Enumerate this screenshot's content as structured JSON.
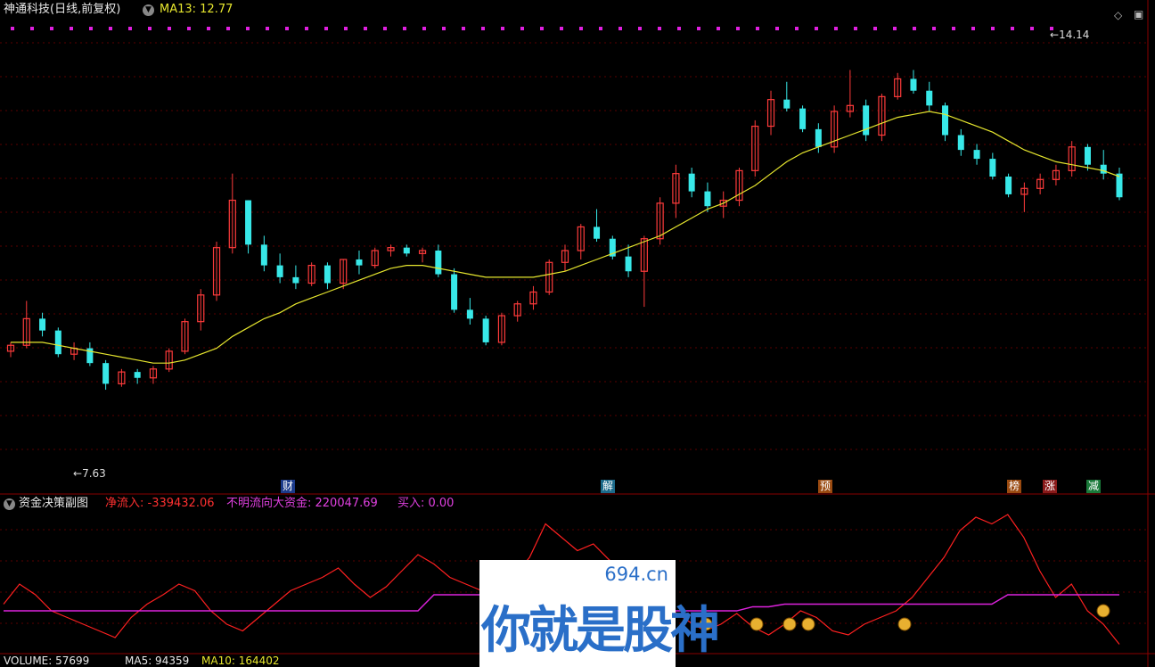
{
  "header": {
    "stock_name": "神通科技(日线,前复权)",
    "ma_label": "MA13: 12.77"
  },
  "price_labels": {
    "high": "14.14",
    "low": "7.63"
  },
  "markers": [
    {
      "text": "财",
      "color": "#1b3a8a"
    },
    {
      "text": "解",
      "color": "#1b6a8a"
    },
    {
      "text": "预",
      "color": "#9a4a10"
    },
    {
      "text": "榜",
      "color": "#9a4a10"
    },
    {
      "text": "涨",
      "color": "#8a1a1a"
    },
    {
      "text": "减",
      "color": "#1a7a3a"
    }
  ],
  "subchart": {
    "title": "资金决策副图",
    "net_inflow": "净流入: -339432.06",
    "unknown_flow": "不明流向大资金: 220047.69",
    "buy": "买入: 0.00"
  },
  "volume": {
    "vol": "VOLUME: 57699",
    "ma5": "MA5: 94359",
    "ma10": "MA10: 164402"
  },
  "watermark": {
    "url": "694.cn",
    "text": "你就是股神"
  },
  "colors": {
    "up": "#ff3b3b",
    "down": "#38e8e8",
    "ma": "#e6e62e",
    "net": "#ff2020",
    "flow": "#dd22dd",
    "grid": "#5a0000"
  },
  "chart_data": {
    "type": "candlestick",
    "ohlc": [
      [
        9.05,
        9.2,
        8.95,
        9.15
      ],
      [
        9.15,
        9.9,
        9.1,
        9.6
      ],
      [
        9.6,
        9.7,
        9.3,
        9.4
      ],
      [
        9.4,
        9.45,
        8.95,
        9.0
      ],
      [
        9.0,
        9.2,
        8.9,
        9.1
      ],
      [
        9.1,
        9.2,
        8.8,
        8.85
      ],
      [
        8.85,
        8.9,
        8.4,
        8.5
      ],
      [
        8.5,
        8.75,
        8.45,
        8.7
      ],
      [
        8.7,
        8.75,
        8.5,
        8.6
      ],
      [
        8.6,
        8.8,
        8.5,
        8.75
      ],
      [
        8.75,
        9.1,
        8.7,
        9.05
      ],
      [
        9.05,
        9.6,
        9.0,
        9.55
      ],
      [
        9.55,
        10.1,
        9.4,
        10.0
      ],
      [
        10.0,
        10.9,
        9.9,
        10.8
      ],
      [
        10.8,
        12.05,
        10.7,
        11.6
      ],
      [
        11.6,
        11.6,
        10.7,
        10.85
      ],
      [
        10.85,
        11.0,
        10.4,
        10.5
      ],
      [
        10.5,
        10.7,
        10.2,
        10.3
      ],
      [
        10.3,
        10.5,
        10.1,
        10.2
      ],
      [
        10.2,
        10.55,
        10.15,
        10.5
      ],
      [
        10.5,
        10.55,
        10.1,
        10.2
      ],
      [
        10.2,
        10.6,
        10.1,
        10.6
      ],
      [
        10.6,
        10.75,
        10.35,
        10.5
      ],
      [
        10.5,
        10.8,
        10.45,
        10.75
      ],
      [
        10.75,
        10.85,
        10.65,
        10.8
      ],
      [
        10.8,
        10.85,
        10.65,
        10.7
      ],
      [
        10.7,
        10.8,
        10.55,
        10.75
      ],
      [
        10.75,
        10.85,
        10.3,
        10.35
      ],
      [
        10.35,
        10.45,
        9.7,
        9.75
      ],
      [
        9.75,
        9.95,
        9.5,
        9.6
      ],
      [
        9.6,
        9.65,
        9.15,
        9.2
      ],
      [
        9.2,
        9.7,
        9.15,
        9.65
      ],
      [
        9.65,
        9.9,
        9.55,
        9.85
      ],
      [
        9.85,
        10.15,
        9.75,
        10.05
      ],
      [
        10.05,
        10.6,
        10.0,
        10.55
      ],
      [
        10.55,
        10.85,
        10.4,
        10.75
      ],
      [
        10.75,
        11.2,
        10.6,
        11.15
      ],
      [
        11.15,
        11.45,
        10.9,
        10.95
      ],
      [
        10.95,
        11.0,
        10.6,
        10.65
      ],
      [
        10.65,
        10.85,
        10.3,
        10.4
      ],
      [
        10.4,
        11.0,
        9.8,
        10.95
      ],
      [
        10.95,
        11.65,
        10.85,
        11.55
      ],
      [
        11.55,
        12.2,
        11.3,
        12.05
      ],
      [
        12.05,
        12.15,
        11.65,
        11.75
      ],
      [
        11.75,
        11.9,
        11.4,
        11.5
      ],
      [
        11.5,
        11.75,
        11.3,
        11.6
      ],
      [
        11.6,
        12.15,
        11.5,
        12.1
      ],
      [
        12.1,
        12.95,
        12.0,
        12.85
      ],
      [
        12.85,
        13.45,
        12.7,
        13.3
      ],
      [
        13.3,
        13.6,
        13.1,
        13.15
      ],
      [
        13.15,
        13.2,
        12.75,
        12.8
      ],
      [
        12.8,
        12.9,
        12.4,
        12.5
      ],
      [
        12.5,
        13.2,
        12.4,
        13.1
      ],
      [
        13.1,
        13.8,
        13.0,
        13.2
      ],
      [
        13.2,
        13.3,
        12.6,
        12.7
      ],
      [
        12.7,
        13.4,
        12.6,
        13.35
      ],
      [
        13.35,
        13.75,
        13.3,
        13.65
      ],
      [
        13.65,
        13.8,
        13.4,
        13.45
      ],
      [
        13.45,
        13.6,
        13.1,
        13.2
      ],
      [
        13.2,
        13.25,
        12.6,
        12.7
      ],
      [
        12.7,
        12.8,
        12.35,
        12.45
      ],
      [
        12.45,
        12.55,
        12.2,
        12.3
      ],
      [
        12.3,
        12.4,
        11.95,
        12.0
      ],
      [
        12.0,
        12.05,
        11.65,
        11.7
      ],
      [
        11.7,
        11.9,
        11.4,
        11.8
      ],
      [
        11.8,
        12.05,
        11.7,
        11.95
      ],
      [
        11.95,
        12.2,
        11.85,
        12.1
      ],
      [
        12.1,
        12.6,
        12.0,
        12.5
      ],
      [
        12.5,
        12.55,
        12.1,
        12.2
      ],
      [
        12.2,
        12.45,
        11.95,
        12.05
      ],
      [
        12.05,
        12.15,
        11.6,
        11.65
      ]
    ],
    "ma13": [
      9.2,
      9.2,
      9.2,
      9.15,
      9.1,
      9.05,
      9.0,
      8.95,
      8.9,
      8.85,
      8.85,
      8.9,
      9.0,
      9.1,
      9.3,
      9.45,
      9.6,
      9.7,
      9.85,
      9.95,
      10.05,
      10.15,
      10.25,
      10.35,
      10.45,
      10.5,
      10.5,
      10.45,
      10.4,
      10.35,
      10.3,
      10.3,
      10.3,
      10.3,
      10.35,
      10.4,
      10.5,
      10.6,
      10.7,
      10.8,
      10.9,
      11.0,
      11.15,
      11.3,
      11.45,
      11.55,
      11.7,
      11.85,
      12.05,
      12.25,
      12.4,
      12.5,
      12.6,
      12.7,
      12.8,
      12.9,
      13.0,
      13.05,
      13.1,
      13.05,
      12.95,
      12.85,
      12.75,
      12.6,
      12.45,
      12.35,
      12.25,
      12.2,
      12.15,
      12.1,
      12.0
    ],
    "ylim": [
      7.0,
      14.5
    ],
    "net_inflow_series": [
      0.35,
      0.5,
      0.42,
      0.3,
      0.25,
      0.2,
      0.15,
      0.1,
      0.25,
      0.35,
      0.42,
      0.5,
      0.45,
      0.3,
      0.2,
      0.15,
      0.25,
      0.35,
      0.45,
      0.5,
      0.55,
      0.62,
      0.5,
      0.4,
      0.48,
      0.6,
      0.72,
      0.65,
      0.55,
      0.5,
      0.45,
      0.4,
      0.55,
      0.7,
      0.95,
      0.85,
      0.75,
      0.8,
      0.68,
      0.6,
      0.5,
      0.35,
      0.3,
      0.22,
      0.15,
      0.2,
      0.28,
      0.18,
      0.12,
      0.2,
      0.3,
      0.25,
      0.15,
      0.12,
      0.2,
      0.25,
      0.3,
      0.4,
      0.55,
      0.7,
      0.9,
      1.0,
      0.95,
      1.02,
      0.85,
      0.6,
      0.4,
      0.5,
      0.3,
      0.2,
      0.05
    ],
    "flow_series": [
      0.3,
      0.3,
      0.3,
      0.3,
      0.3,
      0.3,
      0.3,
      0.3,
      0.3,
      0.3,
      0.3,
      0.3,
      0.3,
      0.3,
      0.3,
      0.3,
      0.3,
      0.3,
      0.3,
      0.3,
      0.3,
      0.3,
      0.3,
      0.3,
      0.3,
      0.3,
      0.3,
      0.42,
      0.42,
      0.42,
      0.42,
      0.42,
      0.42,
      0.42,
      0.42,
      0.42,
      0.42,
      0.42,
      0.42,
      0.35,
      0.3,
      0.3,
      0.3,
      0.3,
      0.3,
      0.3,
      0.3,
      0.33,
      0.33,
      0.35,
      0.35,
      0.35,
      0.35,
      0.35,
      0.35,
      0.35,
      0.35,
      0.35,
      0.35,
      0.35,
      0.35,
      0.35,
      0.35,
      0.42,
      0.42,
      0.42,
      0.42,
      0.42,
      0.42,
      0.42,
      0.42
    ]
  }
}
